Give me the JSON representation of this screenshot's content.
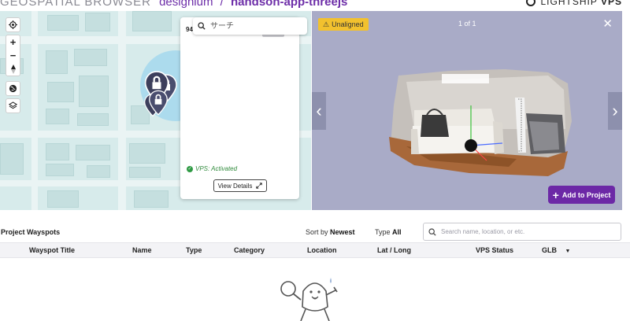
{
  "header": {
    "app_title": "GEOSPATIAL BROWSER",
    "org": "designium",
    "separator": "/",
    "project": "handson-app-threejs",
    "brand_name": "LIGHTSHIP",
    "brand_suffix": "VPS"
  },
  "map": {
    "controls": [
      "locate-icon",
      "zoom-in-icon",
      "zoom-out-icon",
      "compass-icon",
      "globe-icon",
      "layers-icon"
    ],
    "zoom_in": "+",
    "zoom_out": "−"
  },
  "popup": {
    "title_prefix": "94",
    "search_placeholder": "サーチ",
    "vps_status": "VPS: Activated",
    "view_details": "View Details"
  },
  "viewer": {
    "status_badge": "Unaligned",
    "counter": "1 of 1",
    "add_button": "Add to Project"
  },
  "wayspots": {
    "title": "Project Wayspots",
    "sort_label": "Sort by",
    "sort_value": "Newest",
    "type_label": "Type",
    "type_value": "All",
    "search_placeholder": "Search name, location, or etc.",
    "columns": [
      "Wayspot Title",
      "Name",
      "Type",
      "Category",
      "Location",
      "Lat / Long",
      "VPS Status",
      "GLB"
    ]
  },
  "colors": {
    "accent": "#6c28a6",
    "badge": "#f2c12e",
    "viewer_bg": "#a9abc7",
    "map_bg": "#d7ebeb",
    "activated": "#2f8a3b"
  }
}
